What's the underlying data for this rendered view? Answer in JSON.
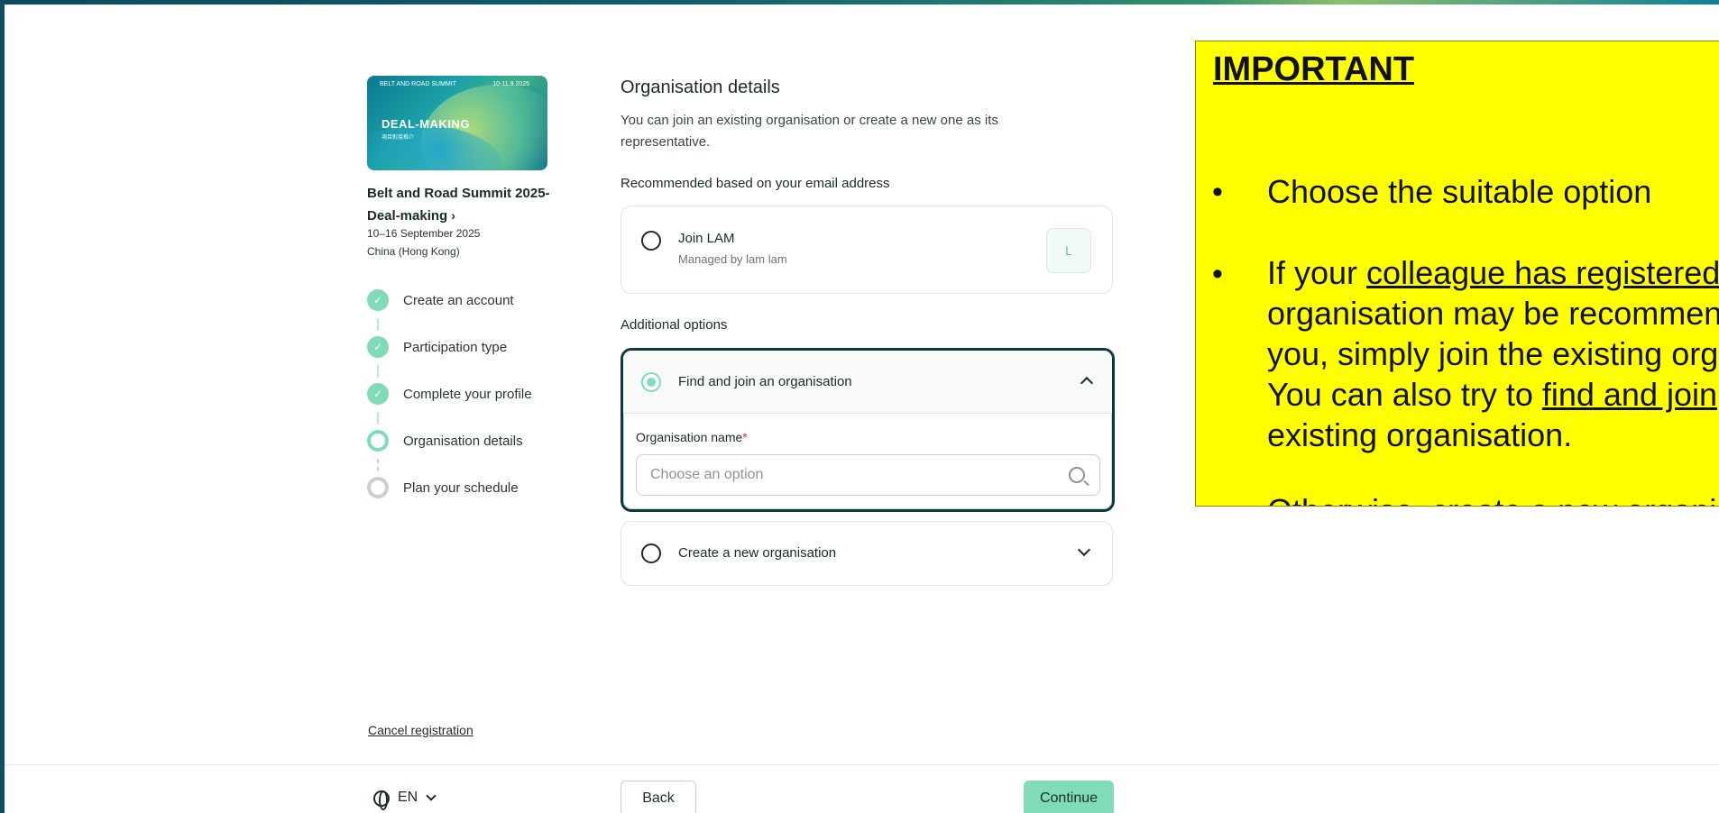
{
  "event": {
    "card_top": "BELT AND ROAD SUMMIT",
    "card_date": "10-11.9.2025",
    "card_title": "DEAL-MAKING",
    "card_sub": "項目對接推介",
    "name": "Belt and Road Summit 2025-Deal-making",
    "dates": "10–16 September 2025",
    "location": "China (Hong Kong)"
  },
  "steps": [
    {
      "label": "Create an account",
      "state": "done"
    },
    {
      "label": "Participation type",
      "state": "done"
    },
    {
      "label": "Complete your profile",
      "state": "done"
    },
    {
      "label": "Organisation details",
      "state": "current"
    },
    {
      "label": "Plan your schedule",
      "state": "pending"
    }
  ],
  "form": {
    "title": "Organisation details",
    "description": "You can join an existing organisation or create a new one as its representative.",
    "recommended_heading": "Recommended based on your email address",
    "recommended_option": {
      "label": "Join LAM",
      "sub": "Managed by lam lam",
      "initial": "L"
    },
    "additional_heading": "Additional options",
    "find_join": {
      "label": "Find and join an organisation",
      "field_label": "Organisation name",
      "required_mark": "*",
      "placeholder": "Choose an option"
    },
    "create_new": {
      "label": "Create a new organisation"
    }
  },
  "footer": {
    "cancel": "Cancel registration",
    "language": "EN",
    "back": "Back",
    "continue": "Continue"
  },
  "note": {
    "title": "IMPORTANT",
    "bullet1": "Choose the suitable option",
    "bullet2_pre": "If your ",
    "bullet2_link": "colleague has registered",
    "bullet2_line2": "organisation may be recommended to",
    "bullet2_line3": "you, simply join the existing organisation.",
    "bullet2_line4_pre": "You can also try to ",
    "bullet2_line4_link": "find and join",
    "bullet2_line5": "existing organisation.",
    "bullet3_pre": "Otherwise, ",
    "bullet3_link": "create a new organisation",
    "bullet_char": "•"
  },
  "colors": {
    "accent": "#7fdcb6",
    "focus_border": "#0d3b3b",
    "note_bg": "#ffff00"
  }
}
